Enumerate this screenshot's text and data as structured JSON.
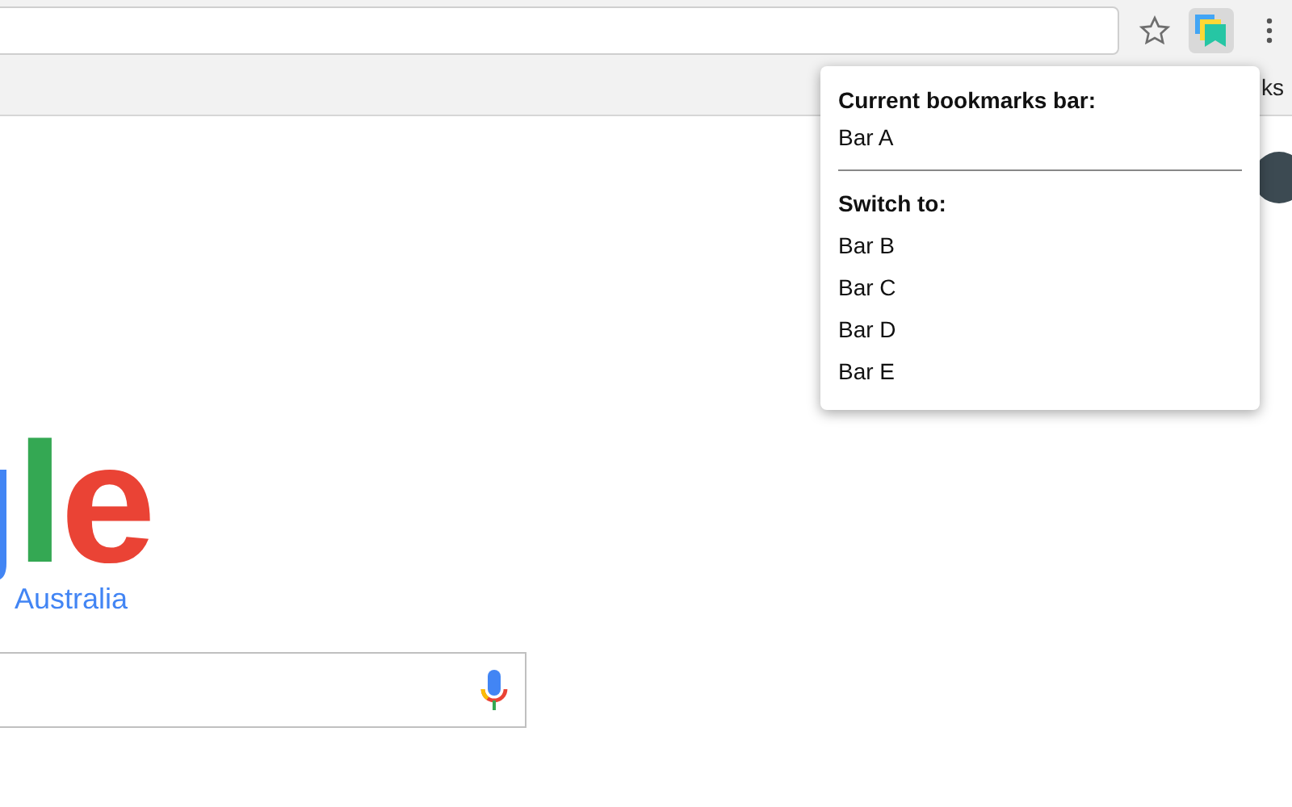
{
  "toolbar": {
    "bookmark_star": {
      "on": false
    },
    "extension": {
      "active": true
    }
  },
  "bookmarks_bar": {
    "text": "ks"
  },
  "popup": {
    "current_heading": "Current bookmarks bar:",
    "current": "Bar A",
    "switch_heading": "Switch to:",
    "bars": [
      {
        "label": "Bar B"
      },
      {
        "label": "Bar C"
      },
      {
        "label": "Bar D"
      },
      {
        "label": "Bar E"
      }
    ]
  },
  "logo": {
    "letters": [
      {
        "text": "l",
        "color": "#34a853"
      },
      {
        "text": "e",
        "color": "#ea4335"
      }
    ],
    "region": "Australia"
  }
}
